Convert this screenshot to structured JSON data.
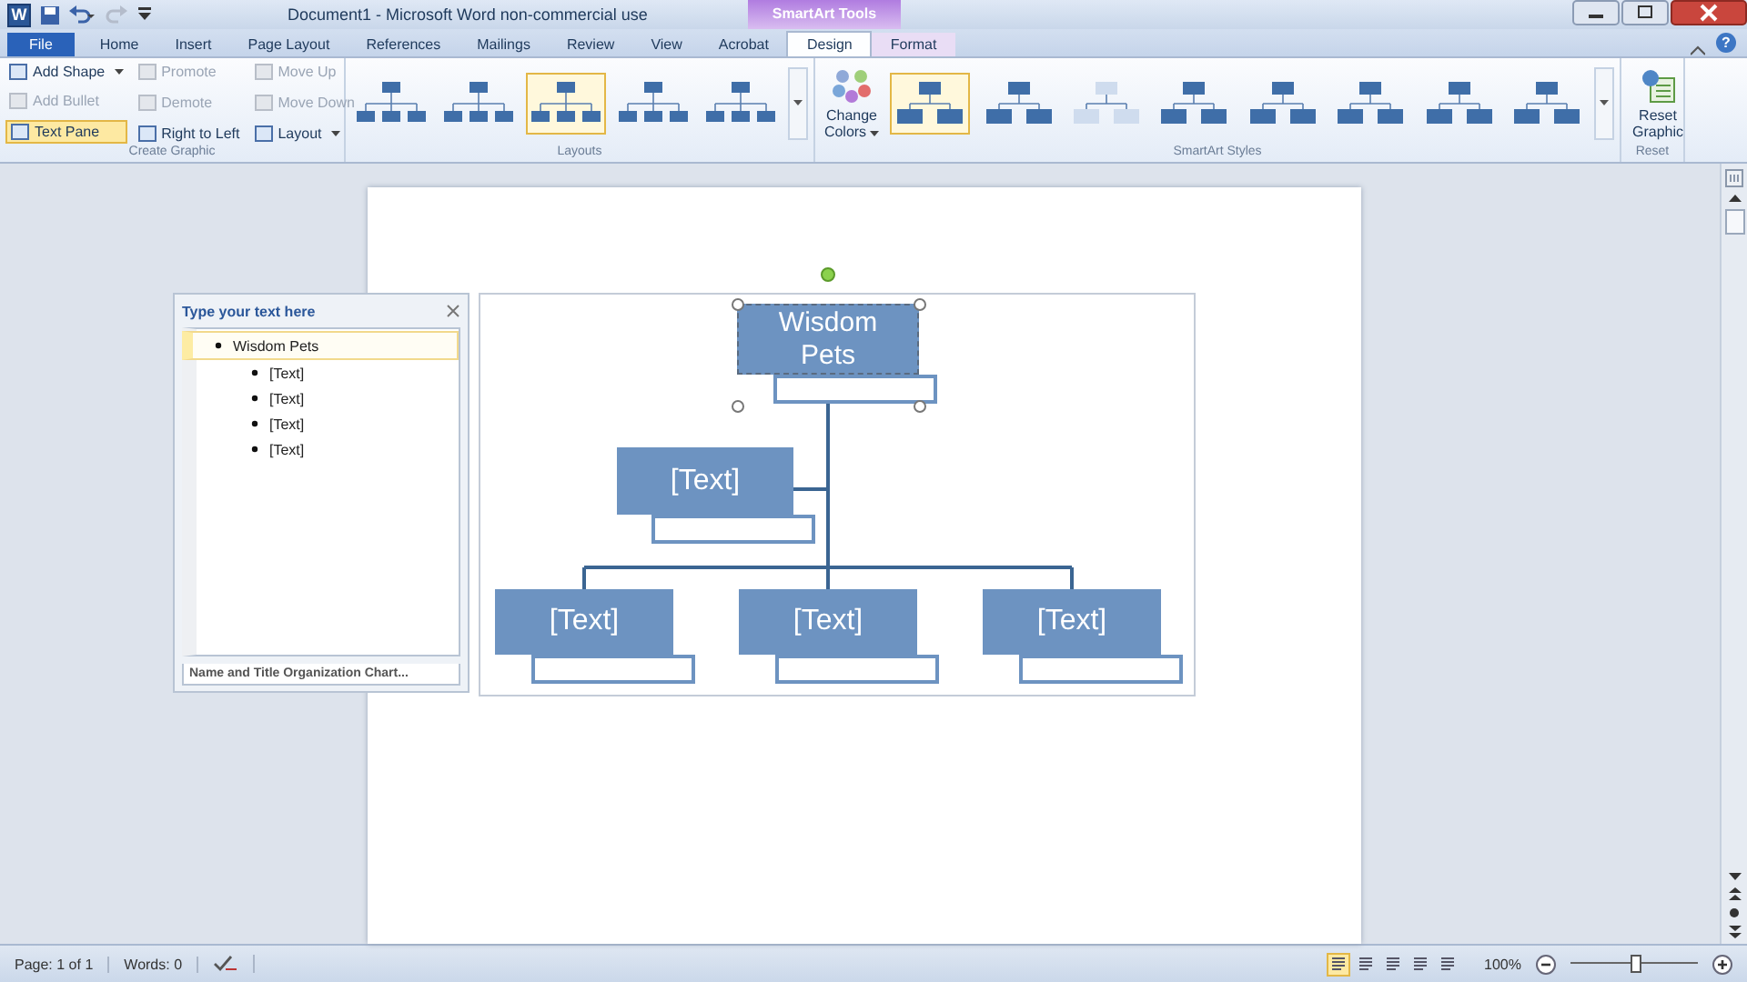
{
  "app_icon": "W",
  "title": "Document1  -  Microsoft Word non-commercial use",
  "contextual_tab": "SmartArt Tools",
  "help": "?",
  "tabs": [
    {
      "label": "File",
      "kind": "file",
      "selected": false
    },
    {
      "label": "Home",
      "kind": "tab",
      "selected": false
    },
    {
      "label": "Insert",
      "kind": "tab",
      "selected": false
    },
    {
      "label": "Page Layout",
      "kind": "tab",
      "selected": false
    },
    {
      "label": "References",
      "kind": "tab",
      "selected": false
    },
    {
      "label": "Mailings",
      "kind": "tab",
      "selected": false
    },
    {
      "label": "Review",
      "kind": "tab",
      "selected": false
    },
    {
      "label": "View",
      "kind": "tab",
      "selected": false
    },
    {
      "label": "Acrobat",
      "kind": "tab",
      "selected": false
    },
    {
      "label": "Design",
      "kind": "contextual",
      "selected": true
    },
    {
      "label": "Format",
      "kind": "contextual",
      "selected": false
    }
  ],
  "create_graphic": {
    "label": "Create Graphic",
    "columns": [
      [
        {
          "label": "Add Shape",
          "disabled": false,
          "selected": false,
          "dropdown": true
        },
        {
          "label": "Add Bullet",
          "disabled": true,
          "selected": false,
          "dropdown": false
        },
        {
          "label": "Text Pane",
          "disabled": false,
          "selected": true,
          "dropdown": false
        }
      ],
      [
        {
          "label": "Promote",
          "disabled": true,
          "selected": false,
          "dropdown": false
        },
        {
          "label": "Demote",
          "disabled": true,
          "selected": false,
          "dropdown": false
        },
        {
          "label": "Right to Left",
          "disabled": false,
          "selected": false,
          "dropdown": false
        }
      ],
      [
        {
          "label": "Move Up",
          "disabled": true,
          "selected": false,
          "dropdown": false
        },
        {
          "label": "Move Down",
          "disabled": true,
          "selected": false,
          "dropdown": false
        },
        {
          "label": "Layout",
          "disabled": false,
          "selected": false,
          "dropdown": true
        }
      ]
    ]
  },
  "layouts": {
    "label": "Layouts",
    "items": [
      {
        "selected": false
      },
      {
        "selected": false
      },
      {
        "selected": true
      },
      {
        "selected": false
      },
      {
        "selected": false
      }
    ]
  },
  "change_colors": {
    "label": "Change Colors",
    "dropdown": true
  },
  "styles": {
    "label": "SmartArt Styles",
    "items": [
      {
        "selected": true
      },
      {
        "selected": false
      },
      {
        "selected": false
      },
      {
        "selected": false
      },
      {
        "selected": false
      },
      {
        "selected": false
      },
      {
        "selected": false
      },
      {
        "selected": false
      }
    ]
  },
  "reset": {
    "button": "Reset Graphic",
    "label": "Reset"
  },
  "text_pane": {
    "title": "Type your text here",
    "items": [
      {
        "text": "Wisdom Pets",
        "selected": true,
        "children": [
          {
            "text": "[Text]",
            "selected": false
          },
          {
            "text": "[Text]",
            "selected": false
          },
          {
            "text": "[Text]",
            "selected": false
          },
          {
            "text": "[Text]",
            "selected": false
          }
        ]
      }
    ],
    "footer": "Name and Title Organization Chart..."
  },
  "chart": {
    "top": {
      "text": "Wisdom Pets",
      "selected": true
    },
    "assistant": {
      "text": "[Text]",
      "selected": false
    },
    "children": [
      {
        "text": "[Text]",
        "selected": false
      },
      {
        "text": "[Text]",
        "selected": false
      },
      {
        "text": "[Text]",
        "selected": false
      }
    ]
  },
  "status": {
    "page": "Page: 1 of 1",
    "words": "Words: 0",
    "views": [
      {
        "selected": true
      },
      {
        "selected": false
      },
      {
        "selected": false
      },
      {
        "selected": false
      },
      {
        "selected": false
      }
    ],
    "zoom": {
      "label": "100%",
      "level": 0.5
    }
  }
}
